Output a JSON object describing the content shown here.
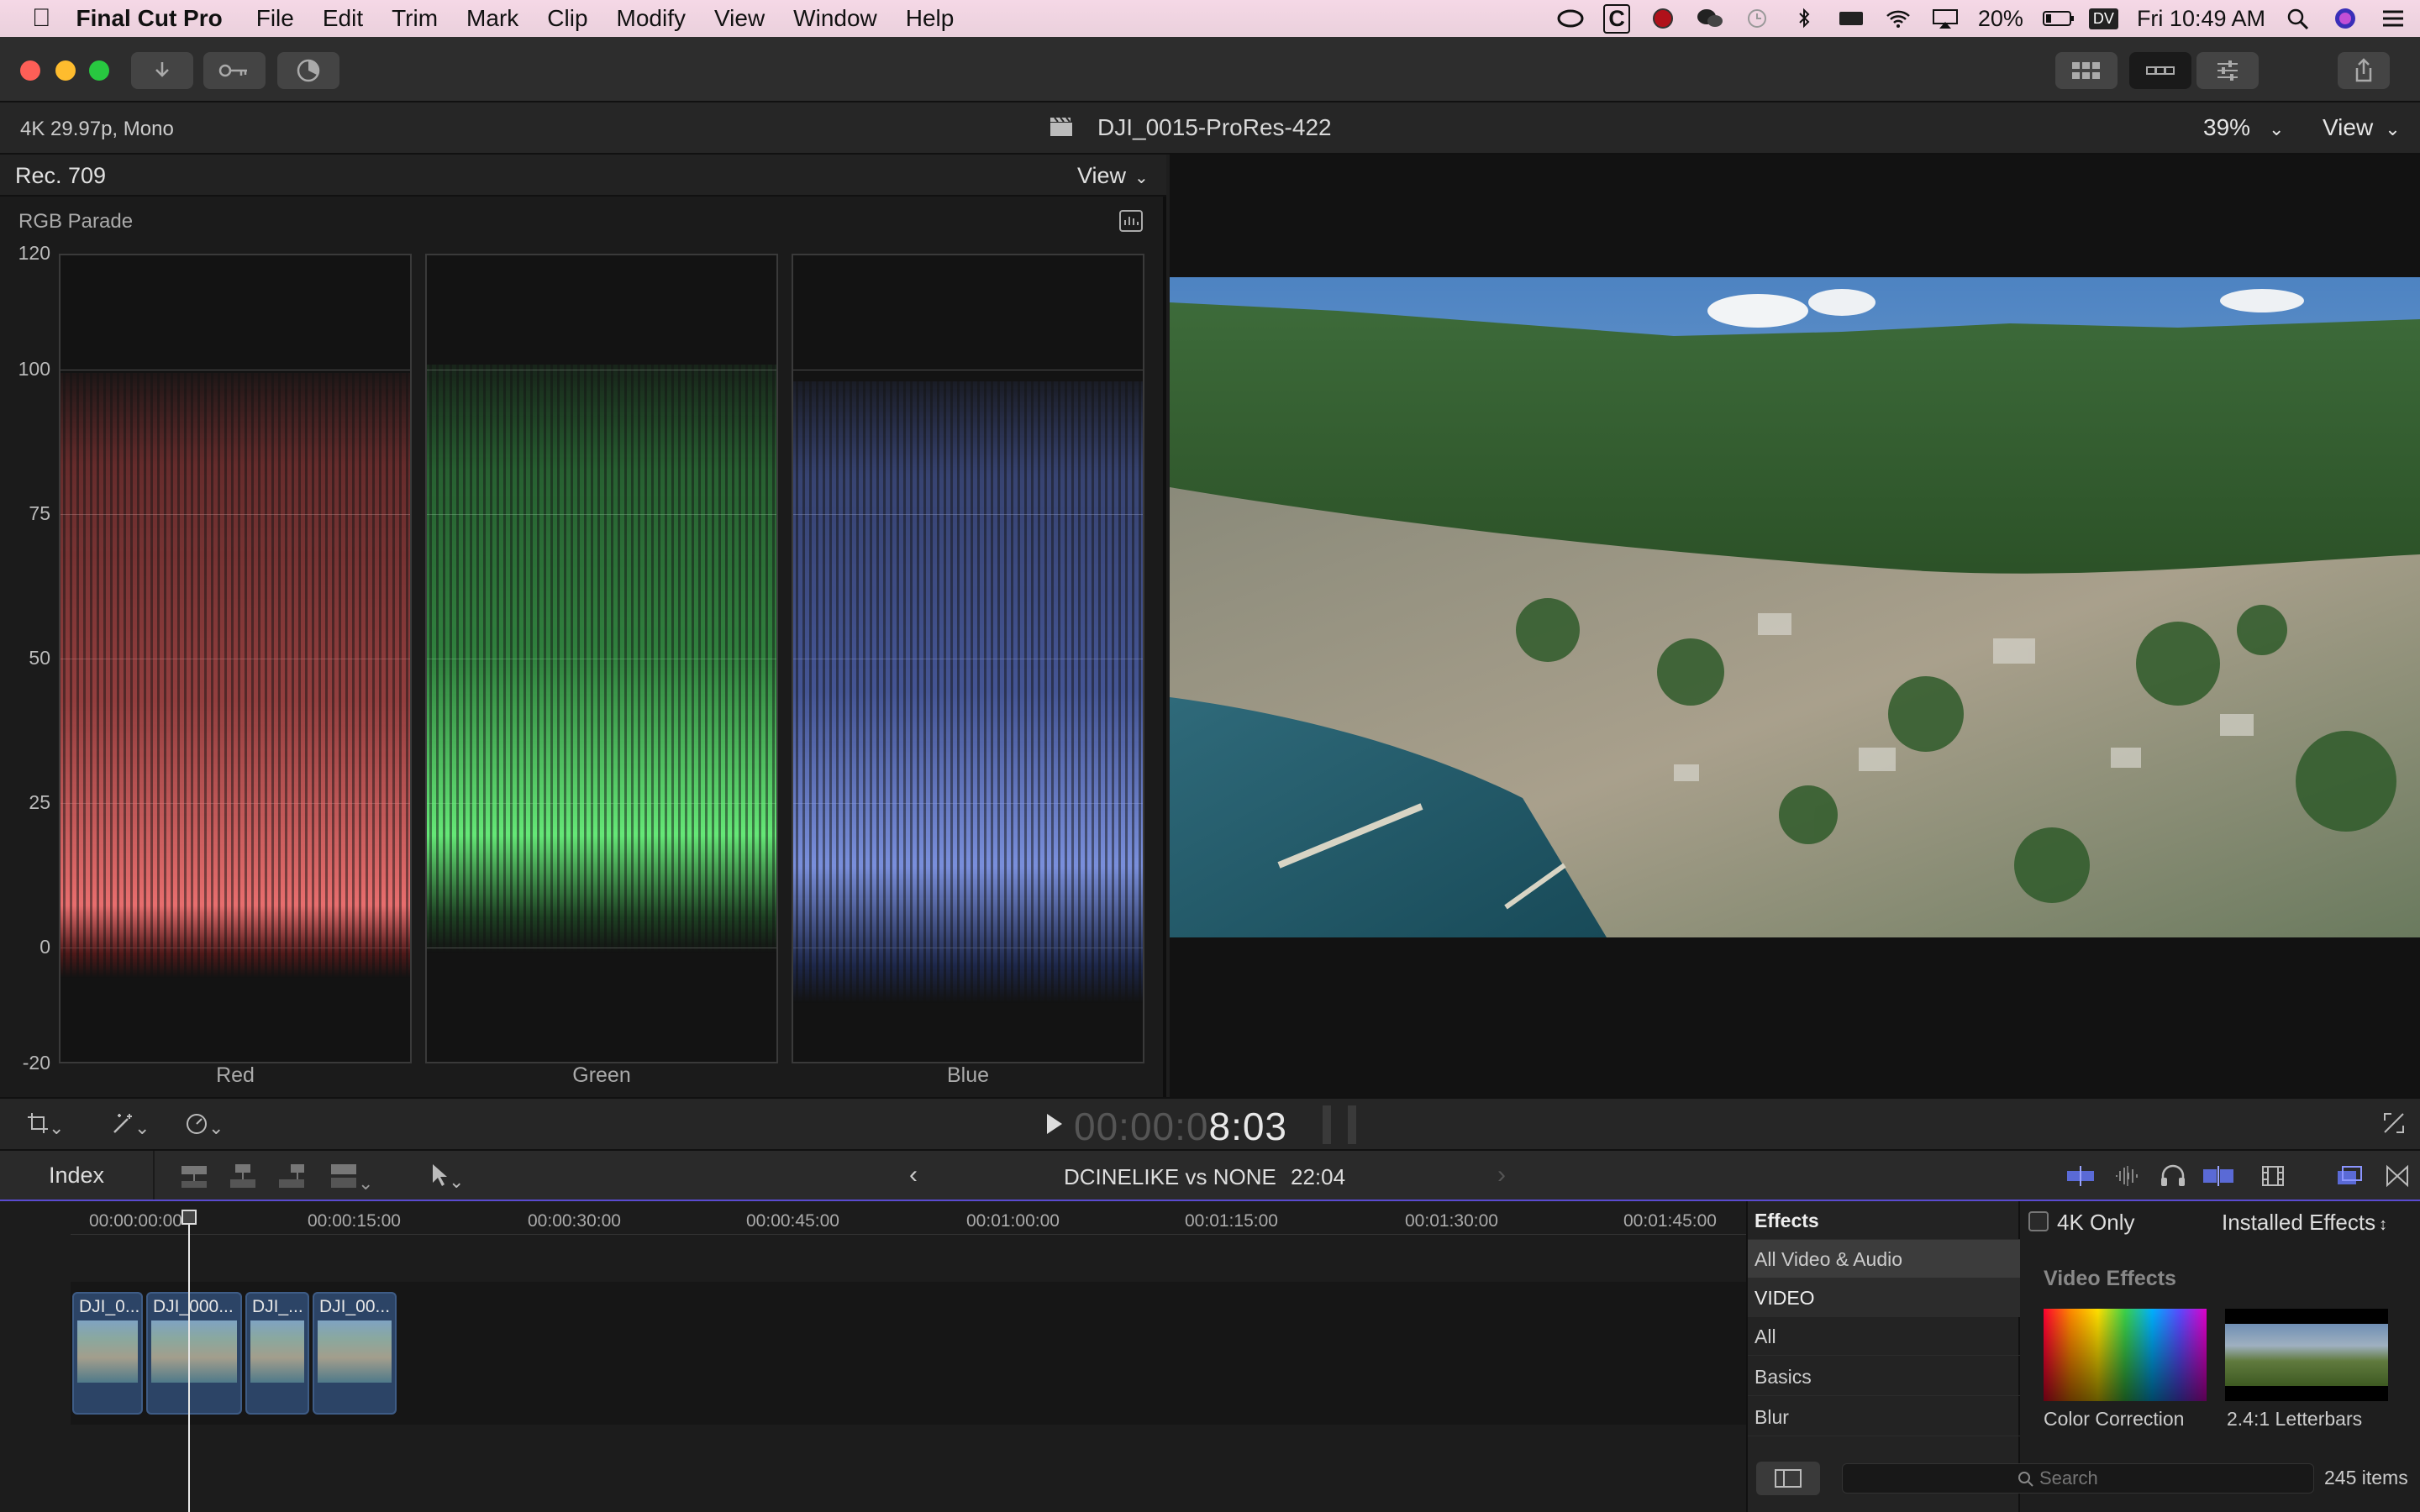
{
  "menubar": {
    "app_name": "Final Cut Pro",
    "items": [
      "File",
      "Edit",
      "Trim",
      "Mark",
      "Clip",
      "Modify",
      "View",
      "Window",
      "Help"
    ],
    "battery": "20%",
    "clock": "Fri 10:49 AM",
    "status_badge": "DV",
    "status_c": "C"
  },
  "infobar": {
    "format": "4K 29.97p, Mono",
    "clip_name": "DJI_0015-ProRes-422",
    "zoom": "39%",
    "view_label": "View"
  },
  "scope": {
    "standard": "Rec. 709",
    "view_label": "View",
    "type": "RGB Parade",
    "y_labels": [
      "120",
      "100",
      "75",
      "50",
      "25",
      "0",
      "-20"
    ],
    "channels": [
      {
        "label": "Red",
        "color": "#ff5a5a"
      },
      {
        "label": "Green",
        "color": "#4ef06a"
      },
      {
        "label": "Blue",
        "color": "#6e8cff"
      }
    ]
  },
  "transport": {
    "timecode_dim": "00:00:0",
    "timecode_bright": "8:03"
  },
  "timeline_header": {
    "index_label": "Index",
    "project_name": "DCINELIKE vs NONE",
    "duration": "22:04"
  },
  "timeline": {
    "ticks": [
      "00:00:00:00",
      "00:00:15:00",
      "00:00:30:00",
      "00:00:45:00",
      "00:01:00:00",
      "00:01:15:00",
      "00:01:30:00",
      "00:01:45:00"
    ],
    "clips": [
      "DJI_0...",
      "DJI_000...",
      "DJI_...",
      "DJI_00..."
    ]
  },
  "effects": {
    "title": "Effects",
    "categories": [
      "All Video & Audio",
      "VIDEO",
      "All",
      "Basics",
      "Blur"
    ],
    "filter_label": "4K Only",
    "installed_label": "Installed Effects",
    "section_title": "Video Effects",
    "items": [
      "Color Correction",
      "2.4:1 Letterbars"
    ],
    "search_placeholder": "Search",
    "count": "245 items"
  }
}
